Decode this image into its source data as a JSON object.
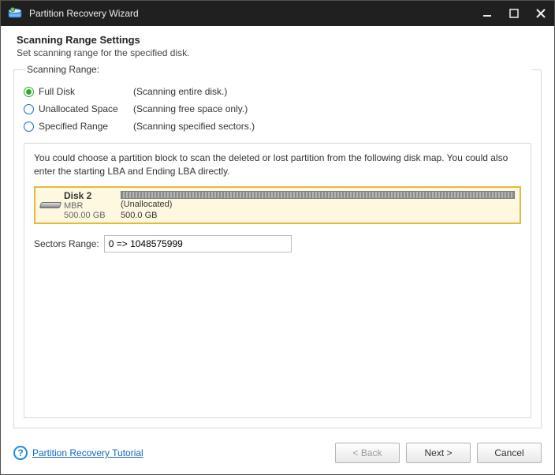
{
  "window": {
    "title": "Partition Recovery Wizard"
  },
  "header": {
    "title": "Scanning Range Settings",
    "subtitle": "Set scanning range for the specified disk."
  },
  "fieldset": {
    "legend": "Scanning Range:",
    "options": [
      {
        "label": "Full Disk",
        "desc": "(Scanning entire disk.)",
        "checked": true
      },
      {
        "label": "Unallocated Space",
        "desc": "(Scanning free space only.)",
        "checked": false
      },
      {
        "label": "Specified Range",
        "desc": "(Scanning specified sectors.)",
        "checked": false
      }
    ],
    "instruction": "You could choose a partition block to scan the deleted or lost partition from the following disk map. You could also enter the starting LBA and Ending LBA directly.",
    "disk": {
      "name": "Disk 2",
      "scheme": "MBR",
      "size": "500.00 GB",
      "block_label": "(Unallocated)",
      "block_size": "500.0 GB"
    },
    "sectors": {
      "label": "Sectors Range:",
      "value": "0 => 1048575999"
    }
  },
  "footer": {
    "tutorial_link": "Partition Recovery Tutorial",
    "buttons": {
      "back": "< Back",
      "next": "Next >",
      "cancel": "Cancel"
    }
  }
}
